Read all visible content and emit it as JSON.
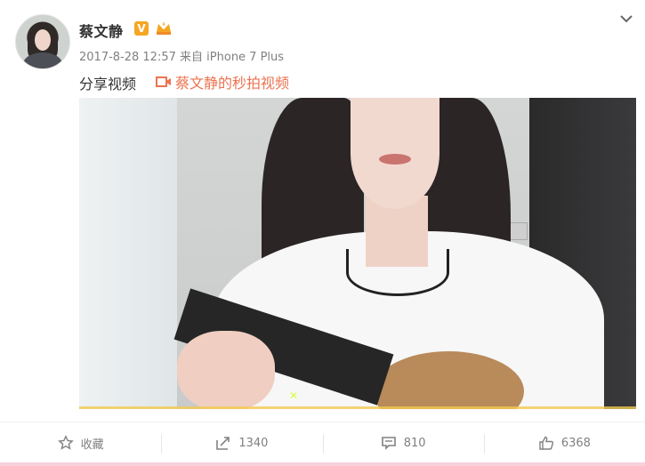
{
  "post": {
    "username": "蔡文静",
    "verified_badge": "V",
    "meta": {
      "date_time": "2017-8-28 12:57",
      "source_prefix": "来自",
      "device": "iPhone 7 Plus"
    },
    "text": "分享视频",
    "video_link_label": "蔡文静的秒拍视频"
  },
  "actions": {
    "favorite_label": "收藏",
    "repost_count": "1340",
    "comment_count": "810",
    "like_count": "6368"
  },
  "colors": {
    "link": "#eb7350",
    "meta": "#808080",
    "badge": "#f5a623"
  },
  "icons": {
    "more": "chevron-down-icon",
    "favorite": "star-icon",
    "repost": "share-arrow-icon",
    "comment": "comment-icon",
    "like": "thumbs-up-icon",
    "video": "video-camera-icon"
  }
}
